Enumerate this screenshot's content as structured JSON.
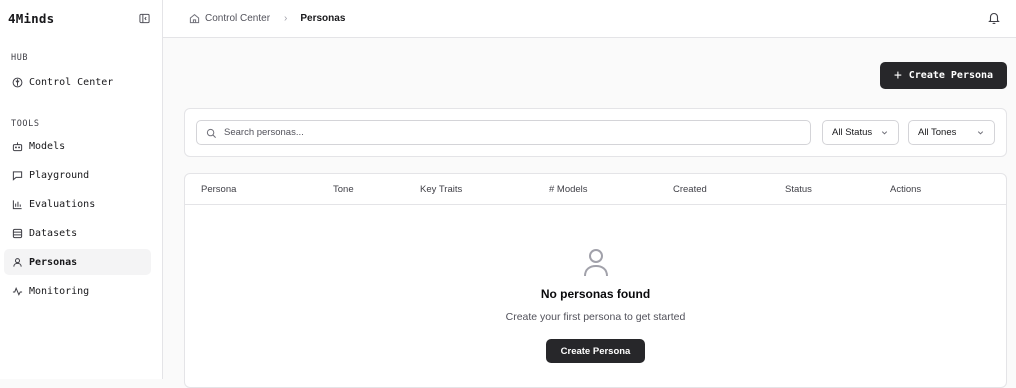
{
  "app": {
    "name": "4Minds"
  },
  "sidebar": {
    "hub_label": "HUB",
    "hub_items": [
      {
        "label": "Control Center",
        "icon": "compass-icon"
      }
    ],
    "tools_label": "TOOLS",
    "tools_items": [
      {
        "label": "Models",
        "icon": "bot-icon"
      },
      {
        "label": "Playground",
        "icon": "message-square-icon"
      },
      {
        "label": "Evaluations",
        "icon": "bar-chart-icon"
      },
      {
        "label": "Datasets",
        "icon": "database-icon"
      },
      {
        "label": "Personas",
        "icon": "user-icon",
        "active": true
      },
      {
        "label": "Monitoring",
        "icon": "activity-icon"
      }
    ]
  },
  "breadcrumb": {
    "home": "Control Center",
    "current": "Personas"
  },
  "header": {
    "create_button": "Create Persona"
  },
  "filters": {
    "search_placeholder": "Search personas...",
    "status_value": "All Status",
    "tone_value": "All Tones"
  },
  "table": {
    "columns": [
      "Persona",
      "Tone",
      "Key Traits",
      "# Models",
      "Created",
      "Status",
      "Actions"
    ]
  },
  "empty_state": {
    "title": "No personas found",
    "subtitle": "Create your first persona to get started",
    "button": "Create Persona"
  },
  "colors": {
    "primary_button": "#27272a",
    "active_nav_bg": "#f4f4f5",
    "border": "#e4e4e7"
  }
}
